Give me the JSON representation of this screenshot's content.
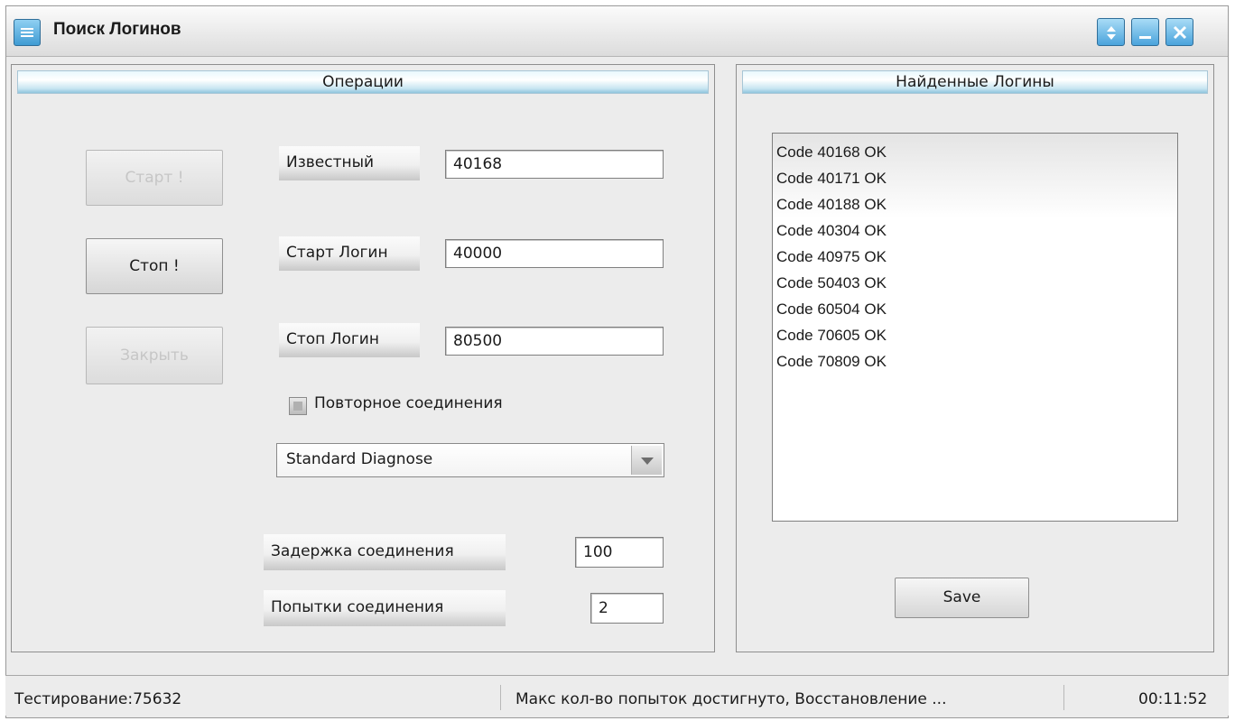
{
  "window": {
    "title": "Поиск Логинов",
    "icon": "app-list-icon"
  },
  "operations": {
    "header": "Операции",
    "start_button": "Старт !",
    "stop_button": "Стоп !",
    "close_button": "Закрыть",
    "known_label": "Известный",
    "known_value": "40168",
    "start_login_label": "Старт Логин",
    "start_login_value": "40000",
    "stop_login_label": "Стоп Логин",
    "stop_login_value": "80500",
    "reconnect_label": "Повторное соединения",
    "mode_value": "Standard Diagnose",
    "delay_label": "Задержка соединения",
    "delay_value": "100",
    "attempts_label": "Попытки соединения",
    "attempts_value": "2"
  },
  "found": {
    "header": "Найденные Логины",
    "items": [
      "Code 40168 OK",
      "Code 40171 OK",
      "Code 40188 OK",
      "Code 40304 OK",
      "Code 40975 OK",
      "Code 50403 OK",
      "Code 60504 OK",
      "Code 70605 OK",
      "Code 70809 OK"
    ],
    "save_button": "Save"
  },
  "status": {
    "left": "Тестирование:75632",
    "middle": "Макс кол-во попыток достигнуто, Восстановление ...",
    "right": "00:11:52"
  },
  "colors": {
    "accent": "#4aa3dc",
    "header_band": "#8fc3dd"
  }
}
